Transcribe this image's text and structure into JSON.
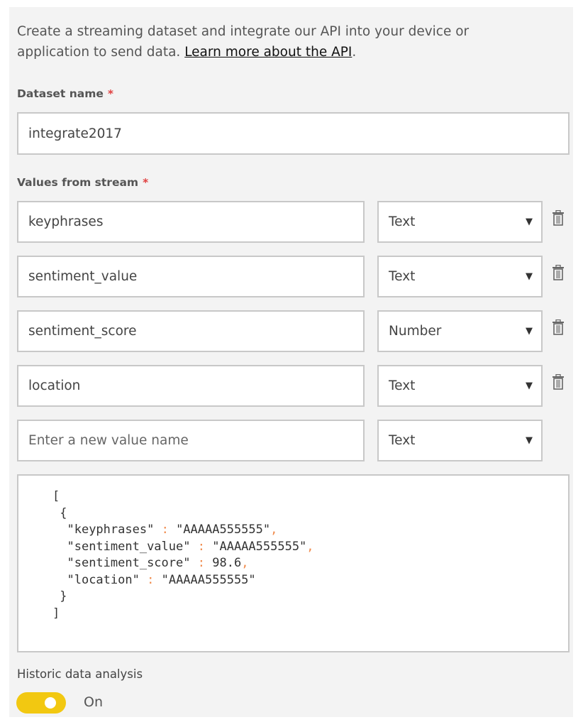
{
  "intro": {
    "text": "Create a streaming dataset and integrate our API into your device or application to send data. ",
    "link": "Learn more about the API",
    "after": "."
  },
  "dataset_name": {
    "label": "Dataset name",
    "required": "*",
    "value": "integrate2017"
  },
  "values": {
    "label": "Values from stream",
    "required": "*",
    "rows": [
      {
        "name": "keyphrases",
        "type": "Text"
      },
      {
        "name": "sentiment_value",
        "type": "Text"
      },
      {
        "name": "sentiment_score",
        "type": "Number"
      },
      {
        "name": "location",
        "type": "Text"
      }
    ],
    "new_row": {
      "placeholder": "Enter a new value name",
      "type": "Text"
    }
  },
  "json_preview": {
    "open_bracket": "[",
    "open_brace": "{",
    "lines": [
      {
        "key": "\"keyphrases\"",
        "value": "\"AAAAA555555\"",
        "comma": ","
      },
      {
        "key": "\"sentiment_value\"",
        "value": "\"AAAAA555555\"",
        "comma": ","
      },
      {
        "key": "\"sentiment_score\"",
        "value": "98.6",
        "comma": ","
      },
      {
        "key": "\"location\"",
        "value": "\"AAAAA555555\"",
        "comma": ""
      }
    ],
    "close_brace": "}",
    "close_bracket": "]"
  },
  "historic": {
    "label": "Historic data analysis",
    "state": "On",
    "enabled": true
  },
  "colors": {
    "toggle": "#f2c811",
    "required": "#e04040",
    "json_punct": "#f08a4b"
  }
}
